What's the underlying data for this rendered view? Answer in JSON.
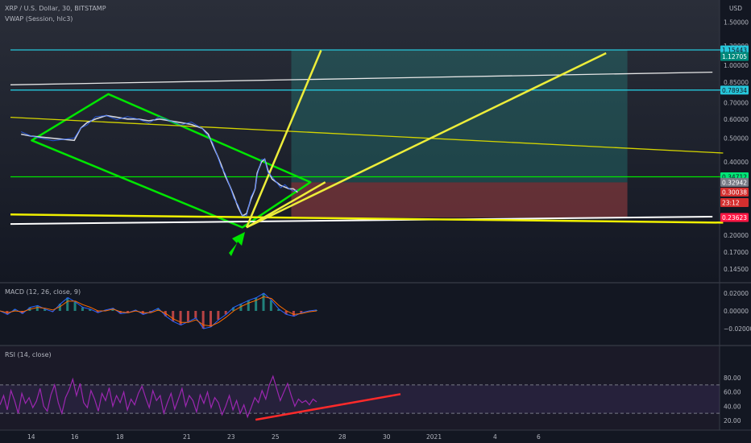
{
  "chart_data": [
    {
      "type": "line",
      "title": "XRP / U.S. Dollar, 30, BITSTAMP",
      "subtitle": "VWAP (Session, hlc3)",
      "currency_label": "USD",
      "y_scale": "log",
      "ylim": [
        0.12,
        1.75
      ],
      "y_ticks": [
        "1.50000",
        "1.20000",
        "1.00000",
        "0.85000",
        "0.70000",
        "0.60000",
        "0.50000",
        "0.40000",
        "0.30000",
        "0.20000",
        "0.17000",
        "0.14500"
      ],
      "price_badges": [
        {
          "label": "1.15443",
          "color": "#26c6da",
          "text_color": "#131722"
        },
        {
          "label": "1.12705",
          "color": "#00897b",
          "text_color": "#ffffff"
        },
        {
          "label": "0.78934",
          "color": "#26c6da",
          "text_color": "#131722"
        },
        {
          "label": "0.34712",
          "color": "#00e676",
          "text_color": "#131722"
        },
        {
          "label": "0.32942",
          "color": "#787b86",
          "text_color": "#ffffff"
        },
        {
          "label": "0.30038",
          "color": "#d32f2f",
          "text_color": "#ffffff"
        },
        {
          "label": "23:12",
          "color": "#d32f2f",
          "text_color": "#ffffff"
        },
        {
          "label": "0.23623",
          "color": "#ff1744",
          "text_color": "#ffffff"
        }
      ],
      "price_series": [
        [
          0.5,
          0.52
        ],
        [
          1,
          0.51
        ],
        [
          2,
          0.5
        ],
        [
          3,
          0.49
        ],
        [
          3.3,
          0.55
        ],
        [
          3.6,
          0.58
        ],
        [
          4,
          0.6
        ],
        [
          4.5,
          0.62
        ],
        [
          5,
          0.61
        ],
        [
          5.5,
          0.6
        ],
        [
          6,
          0.6
        ],
        [
          6.5,
          0.59
        ],
        [
          7,
          0.6
        ],
        [
          7.5,
          0.59
        ],
        [
          8,
          0.58
        ],
        [
          8.5,
          0.57
        ],
        [
          9,
          0.55
        ],
        [
          9.3,
          0.52
        ],
        [
          9.5,
          0.47
        ],
        [
          9.7,
          0.43
        ],
        [
          9.9,
          0.39
        ],
        [
          10.1,
          0.35
        ],
        [
          10.3,
          0.32
        ],
        [
          10.5,
          0.29
        ],
        [
          10.7,
          0.26
        ],
        [
          10.9,
          0.24
        ],
        [
          11.1,
          0.245
        ],
        [
          11.3,
          0.28
        ],
        [
          11.5,
          0.31
        ],
        [
          11.6,
          0.36
        ],
        [
          11.8,
          0.4
        ],
        [
          11.95,
          0.41
        ],
        [
          12.1,
          0.37
        ],
        [
          12.3,
          0.34
        ],
        [
          12.5,
          0.33
        ],
        [
          12.7,
          0.32
        ],
        [
          12.9,
          0.315
        ],
        [
          13.1,
          0.31
        ],
        [
          13.3,
          0.31
        ],
        [
          13.5,
          0.3
        ]
      ],
      "shapes": [
        {
          "name": "green-channel",
          "kind": "polygon",
          "color": "#00e600",
          "points": [
            [
              1,
              0.49
            ],
            [
              4.6,
              0.76
            ],
            [
              14.1,
              0.33
            ],
            [
              10.9,
              0.215
            ]
          ]
        },
        {
          "name": "green-horizontal-line",
          "kind": "line",
          "color": "#00e600",
          "points": [
            [
              0,
              0.34712
            ],
            [
              33.5,
              0.34712
            ]
          ]
        },
        {
          "name": "cyan-upper-line",
          "kind": "line",
          "color": "#26c6da",
          "points": [
            [
              0,
              1.15443
            ],
            [
              33.5,
              1.15443
            ]
          ]
        },
        {
          "name": "cyan-lower-line",
          "kind": "line",
          "color": "#26c6da",
          "points": [
            [
              0,
              0.78934
            ],
            [
              33.5,
              0.78934
            ]
          ]
        },
        {
          "name": "white-upper-line",
          "kind": "line",
          "color": "#e6e6e6",
          "points": [
            [
              0,
              0.83
            ],
            [
              33,
              0.935
            ]
          ]
        },
        {
          "name": "white-lower-line",
          "kind": "line",
          "color": "#ffffff",
          "points": [
            [
              0,
              0.222
            ],
            [
              33,
              0.238
            ]
          ]
        },
        {
          "name": "thin-yellow-trend",
          "kind": "line",
          "color": "#d4d400",
          "points": [
            [
              0,
              0.61
            ],
            [
              33.5,
              0.435
            ]
          ]
        },
        {
          "name": "thick-yellow-support",
          "kind": "line",
          "color": "#f0f000",
          "points": [
            [
              0,
              0.243
            ],
            [
              33.5,
              0.225
            ]
          ]
        },
        {
          "name": "yellow-fan-steep",
          "kind": "line",
          "color": "#eded3a",
          "points": [
            [
              11.1,
              0.215
            ],
            [
              14.6,
              1.15
            ]
          ]
        },
        {
          "name": "yellow-fan-wide",
          "kind": "line",
          "color": "#eded3a",
          "points": [
            [
              11.1,
              0.215
            ],
            [
              28,
              1.12
            ]
          ]
        },
        {
          "name": "yellow-fan-lower",
          "kind": "line",
          "color": "#eded3a",
          "points": [
            [
              11.1,
              0.215
            ],
            [
              14.8,
              0.33
            ]
          ]
        }
      ],
      "position_tool": {
        "entry": 0.32942,
        "target": 1.15443,
        "stop": 0.236
      },
      "annotation_arrow": {
        "color": "#00e600",
        "direction": "up-right"
      }
    },
    {
      "type": "line",
      "title": "MACD (12, 26, close, 9)",
      "ylim": [
        -0.03,
        0.024
      ],
      "y_ticks": [
        "0.02000",
        "0.00000",
        "−0.02000"
      ],
      "series": [
        {
          "values": [
            0,
            -0.004,
            0.002,
            -0.003,
            0.004,
            0.006,
            0.002,
            -0.001,
            0.008,
            0.015,
            0.01,
            0.004,
            0.002,
            -0.002,
            0.001,
            0.003,
            -0.003,
            -0.002,
            0.001,
            -0.004,
            -0.001,
            0.003,
            -0.006,
            -0.012,
            -0.016,
            -0.012,
            -0.008,
            -0.02,
            -0.018,
            -0.01,
            -0.004,
            0.004,
            0.008,
            0.012,
            0.015,
            0.02,
            0.012,
            0.002,
            -0.004,
            -0.006,
            -0.002,
            0,
            0.001
          ]
        },
        {
          "values": [
            0,
            -0.002,
            0,
            -0.001,
            0.002,
            0.004,
            0.003,
            0.001,
            0.005,
            0.011,
            0.011,
            0.007,
            0.004,
            0,
            0,
            0.002,
            -0.001,
            -0.002,
            0,
            -0.002,
            -0.002,
            0.001,
            -0.003,
            -0.009,
            -0.013,
            -0.013,
            -0.01,
            -0.016,
            -0.017,
            -0.013,
            -0.007,
            0,
            0.005,
            0.009,
            0.012,
            0.016,
            0.014,
            0.006,
            0,
            -0.004,
            -0.003,
            -0.001,
            0
          ]
        }
      ]
    },
    {
      "type": "line",
      "title": "RSI (14, close)",
      "ylim": [
        15,
        88
      ],
      "y_ticks": [
        "80.00",
        "60.00",
        "40.00",
        "20.00"
      ],
      "bands": [
        70,
        30
      ],
      "series": [
        {
          "values": [
            42,
            55,
            35,
            62,
            48,
            30,
            58,
            44,
            52,
            38,
            47,
            65,
            40,
            33,
            56,
            70,
            45,
            30,
            52,
            63,
            78,
            55,
            72,
            45,
            38,
            62,
            50,
            33,
            58,
            48,
            66,
            40,
            55,
            45,
            60,
            35,
            50,
            42,
            58,
            68,
            52,
            38,
            62,
            48,
            55,
            30,
            45,
            58,
            36,
            50,
            65,
            40,
            55,
            48,
            32,
            56,
            44,
            60,
            38,
            52,
            45,
            28,
            40,
            55,
            35,
            48,
            30,
            42,
            25,
            38,
            52,
            45,
            62,
            50,
            70,
            82,
            65,
            48,
            60,
            72,
            55,
            40,
            50,
            45,
            48,
            42,
            50,
            46
          ]
        }
      ],
      "divergence_line": {
        "color": "#ff2a2a",
        "points": [
          [
            23.4,
            21
          ],
          [
            31.8,
            57
          ]
        ]
      }
    }
  ],
  "x_axis": {
    "ticks": [
      {
        "label": "14",
        "x": 1
      },
      {
        "label": "16",
        "x": 3
      },
      {
        "label": "18",
        "x": 5
      },
      {
        "label": "21",
        "x": 8
      },
      {
        "label": "23",
        "x": 10
      },
      {
        "label": "25",
        "x": 12
      },
      {
        "label": "28",
        "x": 15
      },
      {
        "label": "30",
        "x": 17
      },
      {
        "label": "2021",
        "x": 19
      },
      {
        "label": "4",
        "x": 22
      },
      {
        "label": "6",
        "x": 24
      }
    ]
  }
}
